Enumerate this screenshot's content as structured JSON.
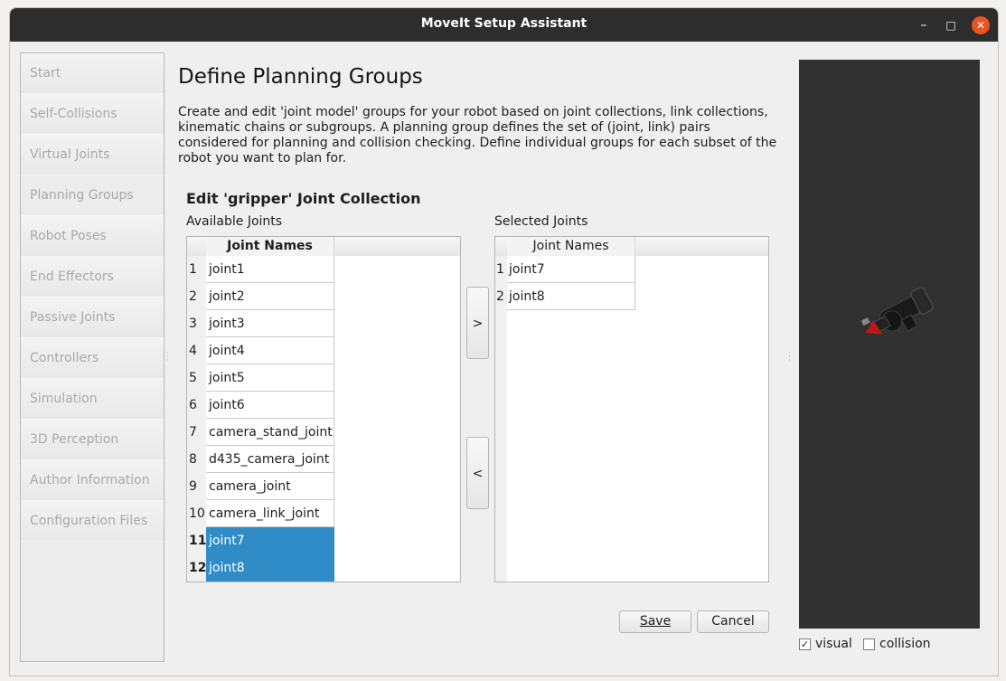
{
  "window": {
    "title": "MoveIt Setup Assistant",
    "minimize_glyph": "–",
    "maximize_glyph": "□",
    "close_glyph": "✕"
  },
  "sidebar": {
    "items": [
      {
        "label": "Start"
      },
      {
        "label": "Self-Collisions"
      },
      {
        "label": "Virtual Joints"
      },
      {
        "label": "Planning Groups"
      },
      {
        "label": "Robot Poses"
      },
      {
        "label": "End Effectors"
      },
      {
        "label": "Passive Joints"
      },
      {
        "label": "Controllers"
      },
      {
        "label": "Simulation"
      },
      {
        "label": "3D Perception"
      },
      {
        "label": "Author Information"
      },
      {
        "label": "Configuration Files"
      }
    ]
  },
  "page": {
    "title": "Define Planning Groups",
    "description": "Create and edit 'joint model' groups for your robot based on joint collections, link collections, kinematic chains or subgroups. A planning group defines the set of (joint, link) pairs considered for planning and collision checking. Define individual groups for each subset of the robot you want to plan for.",
    "edit_heading": "Edit 'gripper' Joint Collection"
  },
  "available": {
    "label": "Available Joints",
    "column_header": "Joint Names",
    "rows": [
      {
        "num": "1",
        "name": "joint1",
        "selected": false
      },
      {
        "num": "2",
        "name": "joint2",
        "selected": false
      },
      {
        "num": "3",
        "name": "joint3",
        "selected": false
      },
      {
        "num": "4",
        "name": "joint4",
        "selected": false
      },
      {
        "num": "5",
        "name": "joint5",
        "selected": false
      },
      {
        "num": "6",
        "name": "joint6",
        "selected": false
      },
      {
        "num": "7",
        "name": "camera_stand_joint",
        "selected": false
      },
      {
        "num": "8",
        "name": "d435_camera_joint",
        "selected": false
      },
      {
        "num": "9",
        "name": "camera_joint",
        "selected": false
      },
      {
        "num": "10",
        "name": "camera_link_joint",
        "selected": false
      },
      {
        "num": "11",
        "name": "joint7",
        "selected": true
      },
      {
        "num": "12",
        "name": "joint8",
        "selected": true
      }
    ]
  },
  "selected": {
    "label": "Selected Joints",
    "column_header": "Joint Names",
    "rows": [
      {
        "num": "1",
        "name": "joint7"
      },
      {
        "num": "2",
        "name": "joint8"
      }
    ]
  },
  "transfer": {
    "add_label": ">",
    "remove_label": "<"
  },
  "actions": {
    "save_label": "Save",
    "cancel_label": "Cancel"
  },
  "viewer": {
    "visual_label": "visual",
    "visual_checked": true,
    "collision_label": "collision",
    "collision_checked": false
  },
  "colors": {
    "title_bar": "#2d2d2d",
    "close_button": "#e95420",
    "selection": "#308cc6",
    "viewer_background": "#313131"
  }
}
